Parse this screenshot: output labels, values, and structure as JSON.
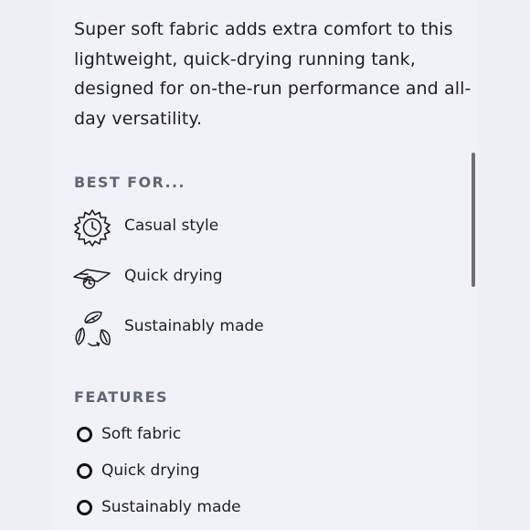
{
  "product": {
    "description": "Super soft fabric adds extra comfort to this lightweight, quick-drying running tank, designed for on-the-run performance and all-day versatility."
  },
  "best_for": {
    "heading": "BEST FOR...",
    "items": [
      {
        "icon": "sun-clock-icon",
        "label": "Casual style"
      },
      {
        "icon": "quick-dry-icon",
        "label": "Quick drying"
      },
      {
        "icon": "recycle-leaves-icon",
        "label": "Sustainably made"
      }
    ]
  },
  "features": {
    "heading": "FEATURES",
    "items": [
      {
        "label": "Soft fabric"
      },
      {
        "label": "Quick drying"
      },
      {
        "label": "Sustainably made"
      }
    ]
  },
  "colors": {
    "background": "#eef0f5",
    "heading": "#606675",
    "text": "#1f1f22",
    "scrollbar": "#6f6f73"
  }
}
